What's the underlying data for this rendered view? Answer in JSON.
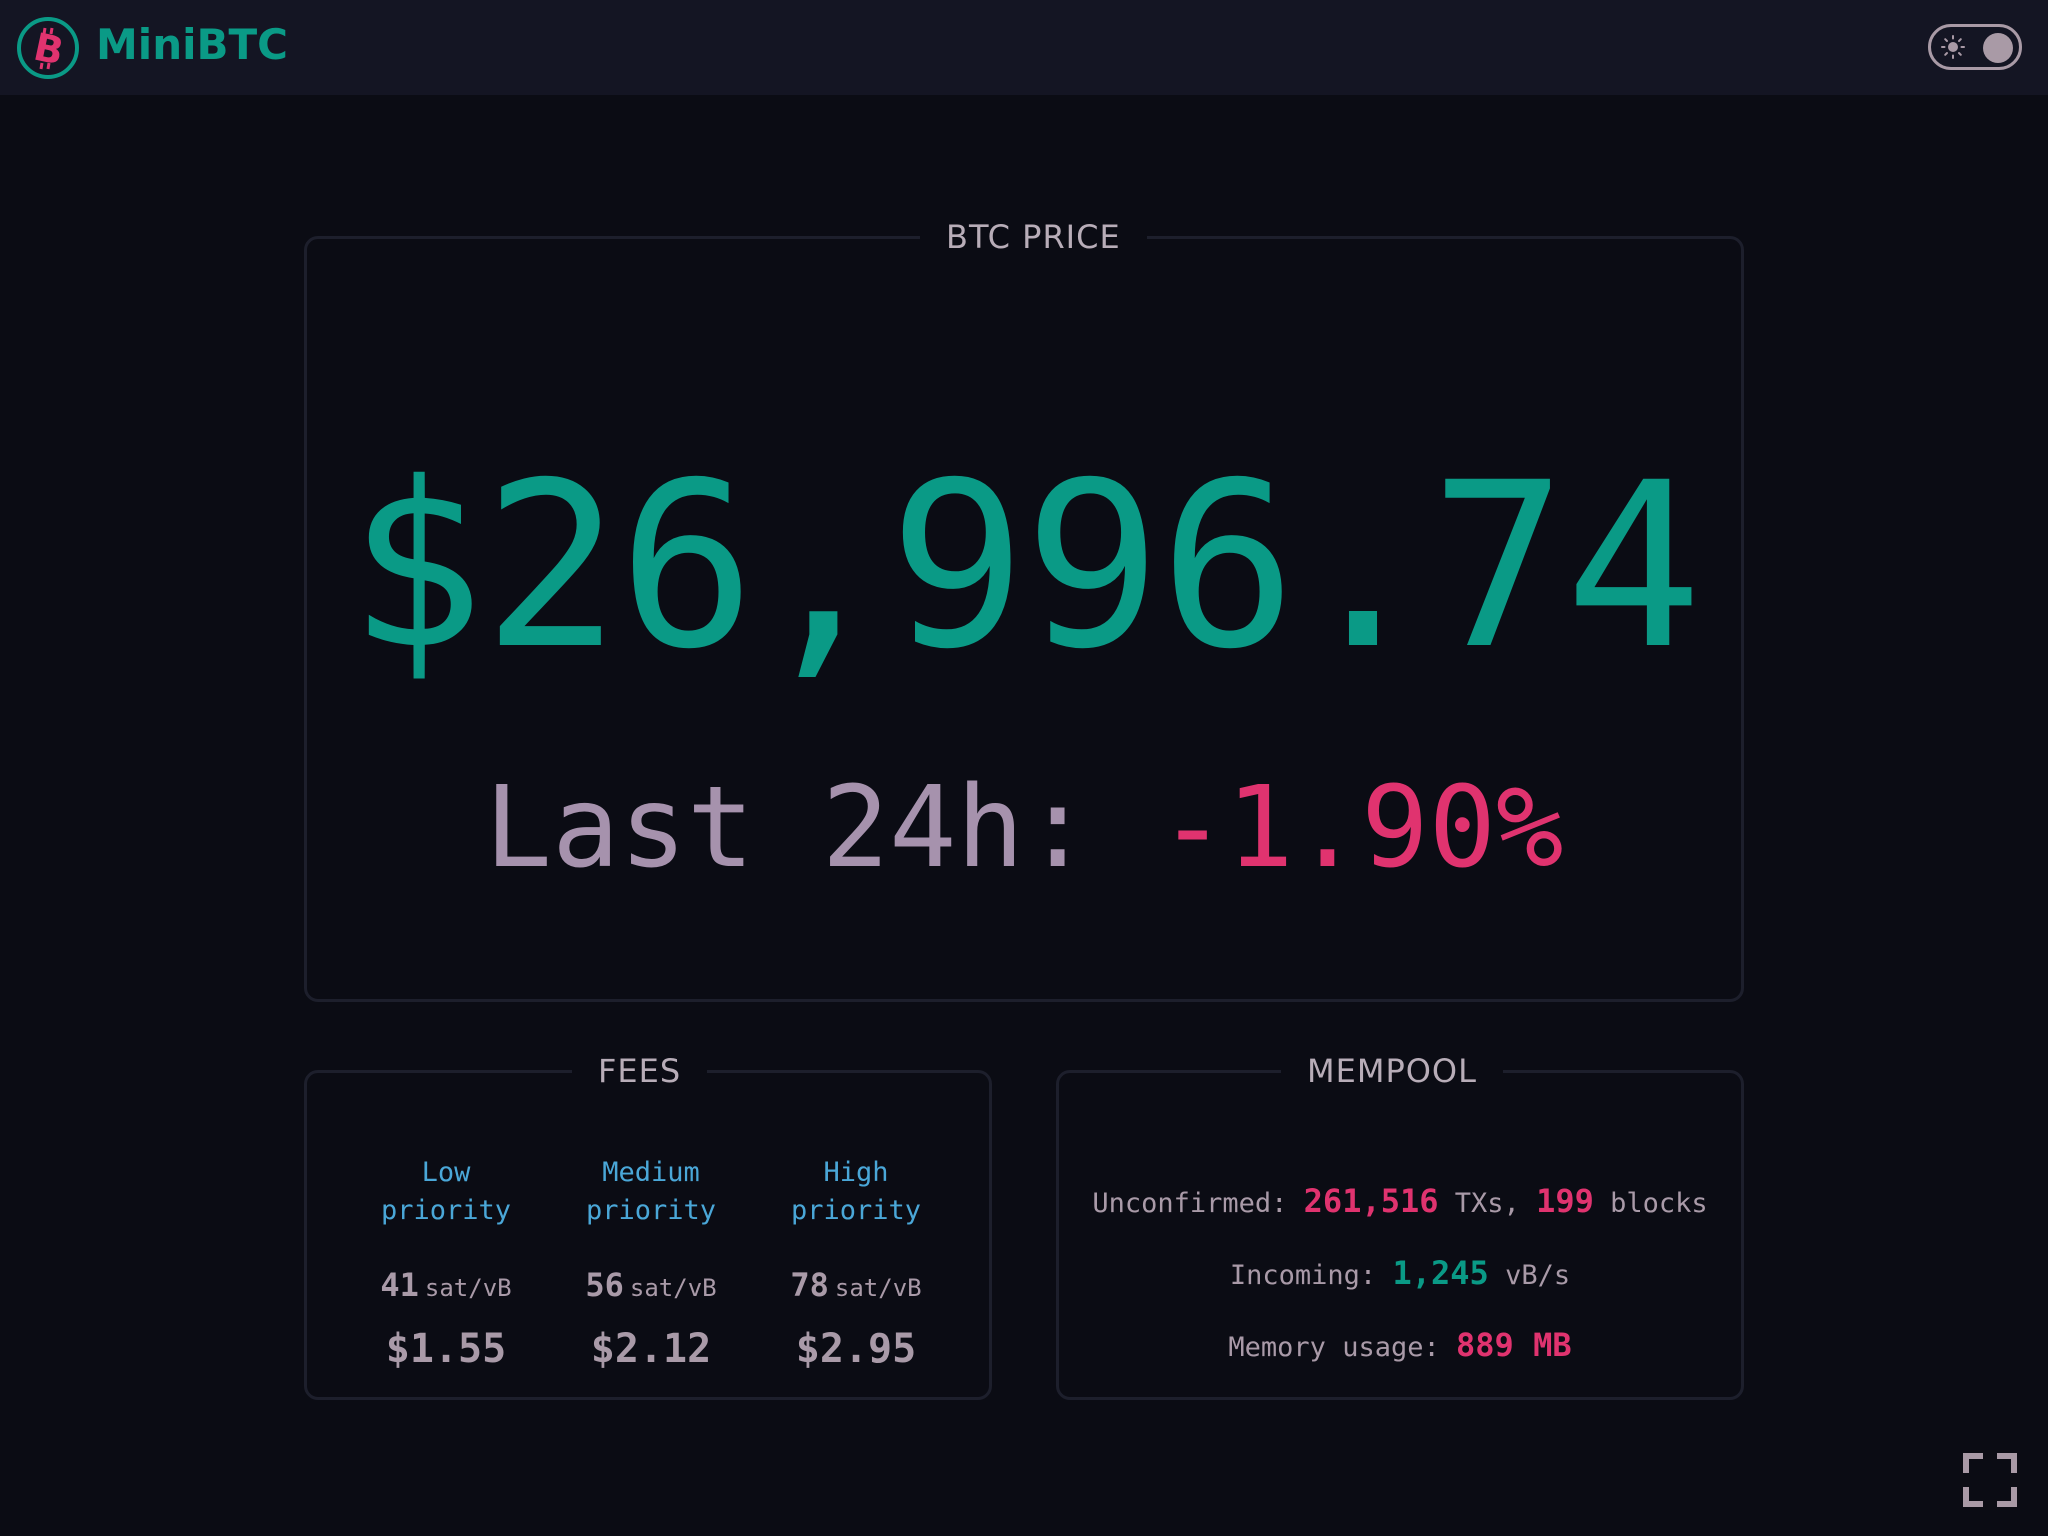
{
  "header": {
    "brand": "MiniBTC",
    "logo_icon": "bitcoin-logo-icon",
    "theme_toggle_icon": "sun-icon",
    "theme_mode": "dark"
  },
  "price": {
    "legend": "BTC PRICE",
    "value": "$26,996.74",
    "change_label": "Last 24h:",
    "change_value": "-1.90%"
  },
  "fees": {
    "legend": "FEES",
    "columns": [
      {
        "title": "Low\npriority",
        "rate": "41",
        "unit": "sat/vB",
        "usd": "$1.55"
      },
      {
        "title": "Medium\npriority",
        "rate": "56",
        "unit": "sat/vB",
        "usd": "$2.12"
      },
      {
        "title": "High\npriority",
        "rate": "78",
        "unit": "sat/vB",
        "usd": "$2.95"
      }
    ]
  },
  "mempool": {
    "legend": "MEMPOOL",
    "unconfirmed_label": "Unconfirmed:",
    "unconfirmed_txs": "261,516",
    "txs_unit": "TXs,",
    "unconfirmed_blocks": "199",
    "blocks_unit": "blocks",
    "incoming_label": "Incoming:",
    "incoming_value": "1,245",
    "incoming_unit": "vB/s",
    "memory_label": "Memory usage:",
    "memory_value": "889 MB"
  },
  "footer": {
    "fullscreen_icon": "fullscreen-icon"
  },
  "colors": {
    "accent": "#0a9a86",
    "negative": "#e0336f",
    "info": "#4aa7d8",
    "background": "#0b0c14"
  }
}
